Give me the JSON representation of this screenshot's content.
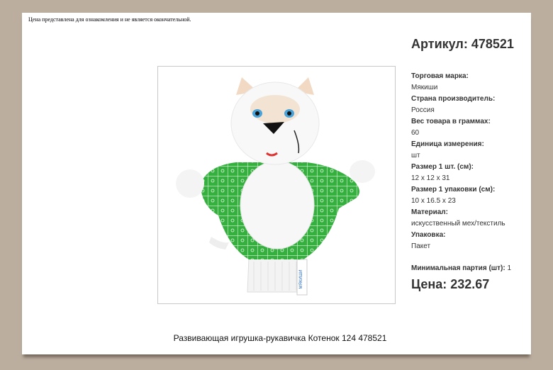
{
  "notice": "Цена представлена для ознакомления и не является окончательной.",
  "sku": "Артикул: 478521",
  "specs": [
    {
      "label": "Торговая марка:",
      "value": "Мякиши"
    },
    {
      "label": "Страна производитель:",
      "value": "Россия"
    },
    {
      "label": "Вес товара в граммах:",
      "value": "60"
    },
    {
      "label": "Единица измерения:",
      "value": "шт"
    },
    {
      "label": "Размер 1 шт. (см):",
      "value": "12 x 12 x 31"
    },
    {
      "label": "Размер 1 упаковки (см):",
      "value": "10 x 16.5 x 23"
    },
    {
      "label": "Материал:",
      "value": "искусственный мех/текстиль"
    },
    {
      "label": "Упаковка:",
      "value": "Пакет"
    }
  ],
  "min_lot_label": "Минимальная партия (шт):",
  "min_lot_value": "1",
  "price": "Цена: 232.67",
  "product_title": "Развивающая игрушка-рукавичка Котенок  124 478521",
  "image": {
    "alt": "Hand puppet kitten toy",
    "tag_text": "МЯКИШИ"
  },
  "colors": {
    "background": "#bcae9f",
    "glove_green": "#3cb043"
  }
}
